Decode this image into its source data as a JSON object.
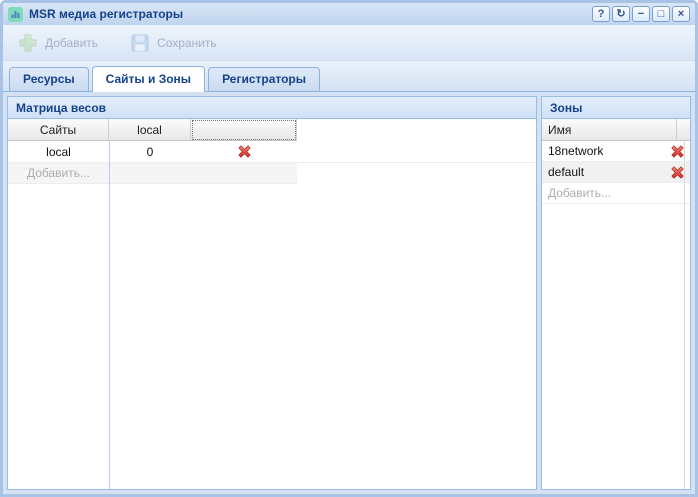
{
  "window": {
    "title": "MSR медиа регистраторы",
    "controls": {
      "help": "?",
      "refresh": "↻",
      "minimize": "−",
      "maximize": "□",
      "close": "×"
    }
  },
  "toolbar": {
    "add_label": "Добавить",
    "save_label": "Сохранить",
    "buttons_disabled": true
  },
  "tabs": [
    {
      "label": "Ресурсы",
      "active": false
    },
    {
      "label": "Сайты и Зоны",
      "active": true
    },
    {
      "label": "Регистраторы",
      "active": false
    }
  ],
  "matrix_panel": {
    "title": "Матрица весов",
    "columns": [
      "Сайты",
      "local",
      ""
    ],
    "rows": [
      {
        "site": "local",
        "weight": "0"
      }
    ],
    "add_row_label": "Добавить..."
  },
  "zones_panel": {
    "title": "Зоны",
    "name_column": "Имя",
    "rows": [
      {
        "name": "18network"
      },
      {
        "name": "default"
      }
    ],
    "add_row_label": "Добавить..."
  },
  "colors": {
    "accent_text": "#15428b",
    "window_border": "#a9c3e6",
    "panel_border": "#99bbe8",
    "delete_icon_red": "#c62828",
    "disabled_text": "#a3b1c5"
  }
}
